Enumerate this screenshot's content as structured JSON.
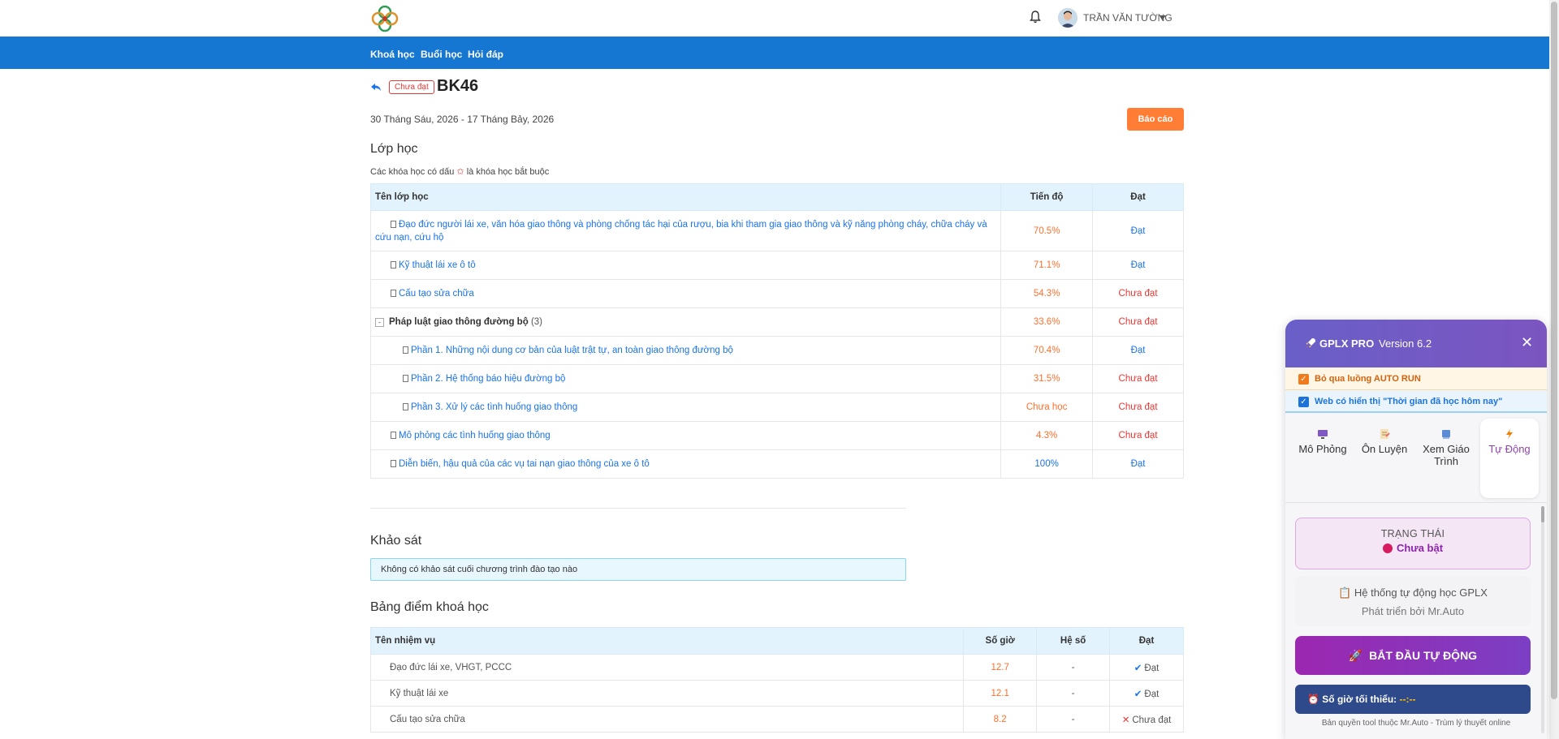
{
  "header": {
    "user_name": "TRẦN VĂN TƯỜNG"
  },
  "nav": {
    "items": [
      "Khoá học",
      "Buổi học",
      "Hỏi đáp"
    ]
  },
  "page": {
    "status_badge": "Chưa đạt",
    "title": "BK46",
    "date_range": "30 Tháng Sáu, 2026 - 17 Tháng Bảy, 2026",
    "report_button": "Báo cáo"
  },
  "classes": {
    "title": "Lớp học",
    "note_before": "Các khóa học có dấu",
    "note_star": "✩",
    "note_after": "là khóa học bắt buộc",
    "columns": [
      "Tên lớp học",
      "Tiến độ",
      "Đạt"
    ],
    "rows": [
      {
        "name": "Đạo đức người lái xe, văn hóa giao thông và phòng chống tác hại của rượu, bia khi tham gia giao thông và kỹ năng phòng cháy, chữa cháy và cứu nạn, cứu hộ",
        "progress": "70.5%",
        "result": "Đạt"
      },
      {
        "name": "Kỹ thuật lái xe ô tô",
        "progress": "71.1%",
        "result": "Đạt"
      },
      {
        "name": "Cấu tạo sửa chữa",
        "progress": "54.3%",
        "result": "Chưa đạt"
      },
      {
        "name": "Pháp luật giao thông đường bộ",
        "count": "(3)",
        "toggle": "-",
        "progress": "33.6%",
        "result": "Chưa đạt"
      },
      {
        "name": "Phần 1. Những nội dung cơ bản của luật trật tự, an toàn giao thông đường bộ",
        "progress": "70.4%",
        "result": "Đạt"
      },
      {
        "name": "Phần 2. Hệ thống báo hiệu đường bộ",
        "progress": "31.5%",
        "result": "Chưa đạt"
      },
      {
        "name": "Phần 3. Xử lý các tình huống giao thông",
        "progress": "Chưa học",
        "result": "Chưa đạt"
      },
      {
        "name": "Mô phỏng các tình huống giao thông",
        "progress": "4.3%",
        "result": "Chưa đạt"
      },
      {
        "name": "Diễn biến, hậu quả của các vụ tai nạn giao thông của xe ô tô",
        "progress": "100%",
        "result": "Đạt"
      }
    ]
  },
  "survey": {
    "title": "Khảo sát",
    "message": "Không có khảo sát cuối chương trình đào tạo nào"
  },
  "scores": {
    "title": "Bảng điểm khoá học",
    "columns": [
      "Tên nhiệm vụ",
      "Số giờ",
      "Hệ số",
      "Đạt"
    ],
    "rows": [
      {
        "name": "Đạo đức lái xe, VHGT, PCCC",
        "hours": "12.7",
        "coef": "-",
        "result": "Đạt"
      },
      {
        "name": "Kỹ thuật lái xe",
        "hours": "12.1",
        "coef": "-",
        "result": "Đạt"
      },
      {
        "name": "Cấu tạo sửa chữa",
        "hours": "8.2",
        "coef": "-",
        "result": "Chưa đạt"
      }
    ]
  },
  "panel": {
    "title": "GPLX PRO",
    "version": "Version 6.2",
    "close": "✕",
    "option_skip": "Bỏ qua luồng AUTO RUN",
    "option_web": "Web có hiển thị \"Thời gian đã học hôm nay\"",
    "tabs": [
      "Mô Phỏng",
      "Ôn Luyện",
      "Xem Giáo Trình",
      "Tự Động"
    ],
    "status_label": "TRẠNG THÁI",
    "status_value": "Chưa bật",
    "system_title": "Hệ thống tự động học GPLX",
    "system_sub": "Phát triển bởi Mr.Auto",
    "start_button": "BẮT ĐẦU TỰ ĐỘNG",
    "min_hours_label": "Số giờ tối thiểu:",
    "min_hours_value": "--:--",
    "copyright": "Bản quyền tool thuộc Mr.Auto - Trùm lý thuyết online"
  }
}
